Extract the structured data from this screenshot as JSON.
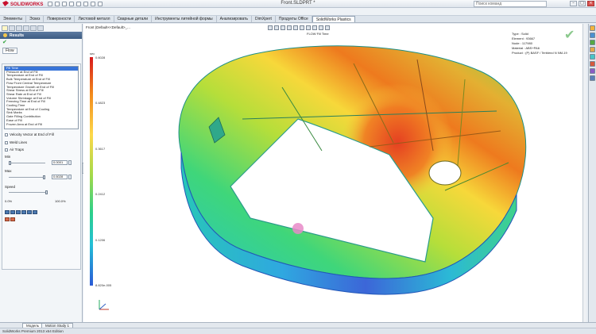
{
  "app": {
    "logo_text": "SOLIDWORKS",
    "window_title": "Front.SLDPRT *",
    "search_placeholder": "Поиск команд"
  },
  "command_tabs": [
    {
      "label": "Элементы",
      "active": false
    },
    {
      "label": "Эскиз",
      "active": false
    },
    {
      "label": "Поверхности",
      "active": false
    },
    {
      "label": "Листовой металл",
      "active": false
    },
    {
      "label": "Сварные детали",
      "active": false
    },
    {
      "label": "Инструменты литейной формы",
      "active": false
    },
    {
      "label": "Анализировать",
      "active": false
    },
    {
      "label": "DimXpert",
      "active": false
    },
    {
      "label": "Продукты Office",
      "active": false
    },
    {
      "label": "SolidWorks Plastics",
      "active": true
    }
  ],
  "panel": {
    "title": "Results",
    "subtab": "Flow",
    "results_list": [
      "Fill Time",
      "Pressure at End of Fill",
      "Temperature at End of Fill",
      "Bulk Temperature at End of Fill",
      "Flow Front Central Temperature",
      "Temperature Growth at End of Fill",
      "Shear Stress at End of Fill",
      "Shear Rate at End of Fill",
      "Volume Shrinkage at End of Fill",
      "Freezing Time at End of Fill",
      "Cooling Time",
      "Temperature at End of Cooling",
      "Sink Marks",
      "Gate Filling Contribution",
      "Ease of Fill",
      "Frozen Area at End of Fill"
    ],
    "selected_index": 0,
    "velocity_vector_label": "Velocity Vector at End of Fill",
    "weld_lines_label": "Weld Lines",
    "air_traps_label": "Air Traps",
    "min_label": "Min",
    "min_value": "0.0001",
    "max_label": "Max",
    "max_value": "0.6028",
    "speed_label": "Speed",
    "pct_start": "0.0%",
    "pct_end": "100.0%"
  },
  "viewport": {
    "view_title": "Front (Default<<Default>_...",
    "plot_title": "FLOW Fill Time",
    "info_lines": [
      "Type : Solid",
      "Element : 93667",
      "Node : 117980",
      "Material : ABS+PA6",
      "Product : (P) BASF / Terblend N NM-19"
    ],
    "legend_unit": "sec",
    "legend_labels": [
      "0.6028",
      "0.4823",
      "0.3617",
      "0.2412",
      "0.1206",
      "8.820e-005"
    ]
  },
  "bottom_tabs": [
    {
      "label": "Модель",
      "active": true
    },
    {
      "label": "Motion Study 1",
      "active": false
    }
  ],
  "status_text": "SolidWorks Premium 2013 x64 Edition"
}
